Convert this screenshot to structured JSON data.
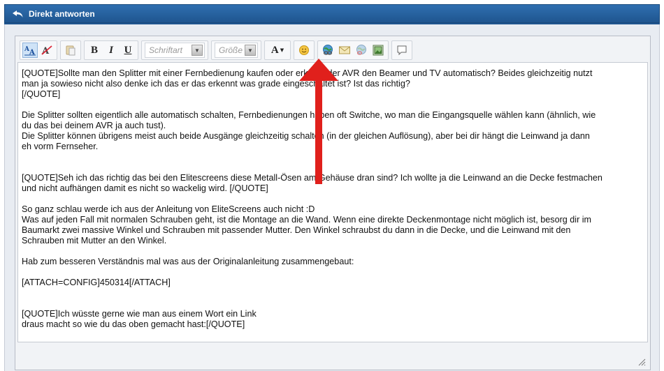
{
  "header": {
    "title": "Direkt antworten"
  },
  "toolbar": {
    "font_select": "Schriftart",
    "size_select": "Größe",
    "font_color": "A"
  },
  "message": {
    "lines": [
      "[QUOTE]Sollte man den Splitter mit einer Fernbedienung kaufen oder erkennt der AVR den Beamer und TV automatisch? Beides gleichzeitig nutzt",
      "man ja sowieso nicht also denke ich das er das erkennt was grade eingeschaltet ist? Ist das richtig?",
      "[/QUOTE]",
      "",
      "Die Splitter sollten eigentlich alle automatisch schalten, Fernbedienungen haben oft Switche, wo man die Eingangsquelle wählen kann (ähnlich, wie",
      "du das bei deinem AVR ja auch tust).",
      "Die Splitter können übrigens meist auch beide Ausgänge gleichzeitig schalten (in der gleichen Auflösung), aber bei dir hängt die Leinwand ja dann",
      "eh vorm Fernseher.",
      "",
      "",
      "[QUOTE]Seh ich das richtig das bei den Elitescreens diese Metall-Ösen am Gehäuse dran sind? Ich wollte ja die Leinwand an die Decke festmachen",
      "und nicht aufhängen damit es nicht so wackelig wird. [/QUOTE]",
      "",
      "So ganz schlau werde ich aus der Anleitung von EliteScreens auch nicht :D",
      "Was auf jeden Fall mit normalen Schrauben geht, ist die Montage an die Wand. Wenn eine direkte Deckenmontage nicht möglich ist, besorg dir im",
      "Baumarkt zwei massive Winkel und Schrauben mit passender Mutter. Den Winkel schraubst du dann in die Decke, und die Leinwand mit den",
      "Schrauben mit Mutter an den Winkel.",
      "",
      "Hab zum besseren Verständnis mal was aus der Originalanleitung zusammengebaut:",
      "",
      "[ATTACH=CONFIG]450314[/ATTACH]",
      "",
      "",
      "[QUOTE]Ich wüsste gerne wie man aus einem Wort ein Link",
      "draus macht so wie du das oben gemacht hast:[/QUOTE]"
    ]
  },
  "colors": {
    "header": "#2f6fb0",
    "annotation_arrow": "#e0201c"
  }
}
